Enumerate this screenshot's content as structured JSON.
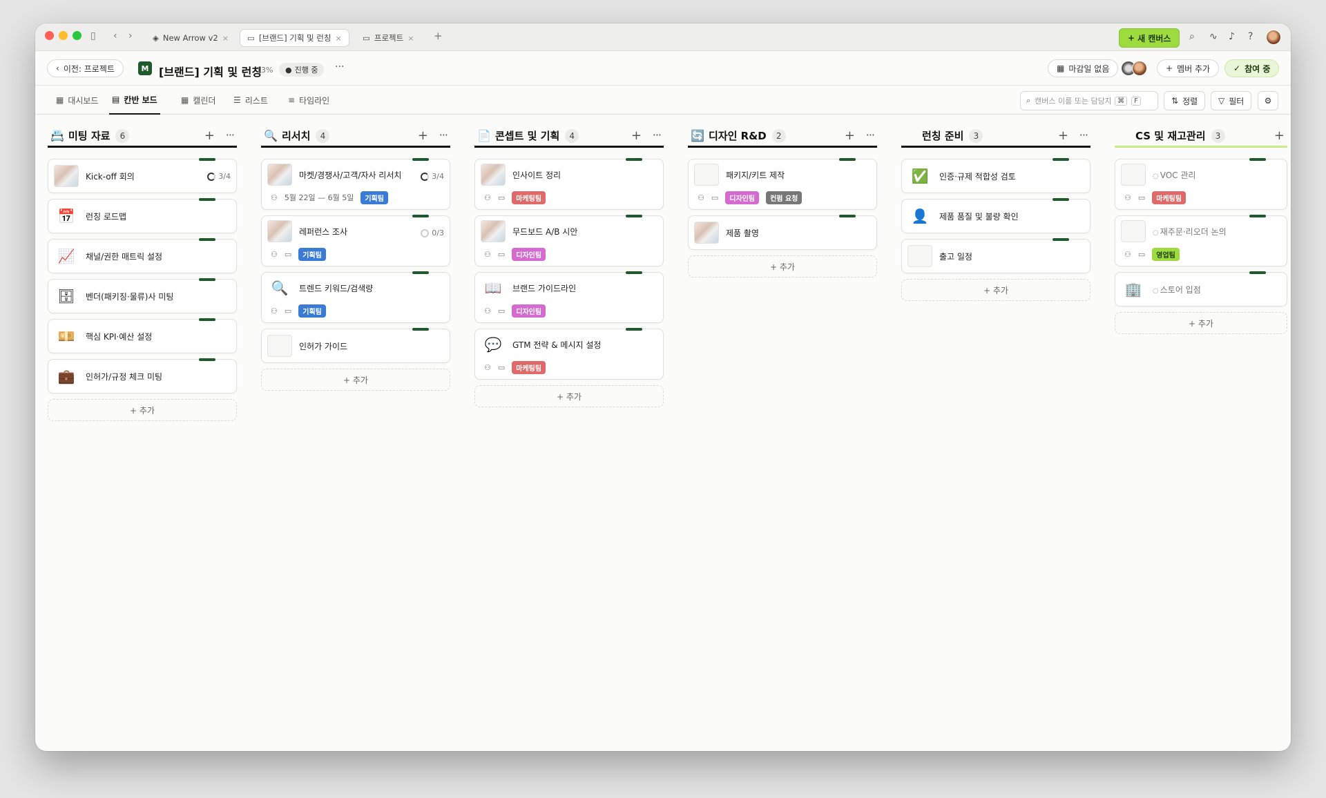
{
  "titlebar": {
    "tabs": [
      {
        "label": "New Arrow v2",
        "icon": "layers-icon"
      },
      {
        "label": "[브랜드] 기획 및 런칭",
        "icon": "folder-icon",
        "active": true
      },
      {
        "label": "프로젝트",
        "icon": "folder-icon"
      }
    ],
    "new_canvas_label": "새 캔버스"
  },
  "header": {
    "back_label": "이전: 프로젝트",
    "title": "[브랜드] 기획 및 런칭",
    "progress": "13%",
    "status": "진행 중",
    "more": "···",
    "deadline": "마감일 없음",
    "add_member": "멤버 추가",
    "participating": "참여 중"
  },
  "nav": {
    "tabs": [
      {
        "label": "대시보드"
      },
      {
        "label": "칸반 보드",
        "active": true
      },
      {
        "label": "캘린더"
      },
      {
        "label": "리스트"
      },
      {
        "label": "타임라인"
      }
    ],
    "search_placeholder": "캔버스 이름 또는 담당자",
    "shortcut_cmd": "⌘",
    "shortcut_key": "F",
    "sort_label": "정렬",
    "filter_label": "필터"
  },
  "add_label": "+ 추가",
  "columns": [
    {
      "name": "미팅 자료",
      "count": "6",
      "icon": "📇",
      "cards": [
        {
          "name": "Kick-off 회의",
          "thumb": "img",
          "progress": "3/4"
        },
        {
          "name": "런칭 로드맵",
          "thumb": "📅"
        },
        {
          "name": "채널/권한 매트릭 설정",
          "thumb": "📈"
        },
        {
          "name": "벤더(패키징·물류)사 미팅",
          "thumb": "🗄"
        },
        {
          "name": "핵심 KPI·예산 설정",
          "thumb": "💴"
        },
        {
          "name": "인허가/규정 체크 미팅",
          "thumb": "💼"
        }
      ]
    },
    {
      "name": "리서치",
      "count": "4",
      "icon": "🔍",
      "cards": [
        {
          "name": "마켓/경쟁사/고객/자사 리서치",
          "thumb": "img",
          "progress": "3/4",
          "date": "5월 22일 — 6월 5일",
          "tags": [
            {
              "label": "기획팀",
              "color": "#3a7bd5"
            }
          ]
        },
        {
          "name": "레퍼런스 조사",
          "thumb": "img",
          "progress": "0/3",
          "progress_empty": true,
          "tags": [
            {
              "label": "기획팀",
              "color": "#3a7bd5"
            }
          ]
        },
        {
          "name": "트렌드 키워드/검색량",
          "thumb": "🔍",
          "tags": [
            {
              "label": "기획팀",
              "color": "#3a7bd5"
            }
          ]
        },
        {
          "name": "인허가 가이드",
          "thumb": "doc"
        }
      ]
    },
    {
      "name": "콘셉트 및 기획",
      "count": "4",
      "icon": "📄",
      "cards": [
        {
          "name": "인사이트 정리",
          "thumb": "img",
          "tags": [
            {
              "label": "마케팅팀",
              "color": "#e06a6a"
            }
          ]
        },
        {
          "name": "무드보드 A/B 시안",
          "thumb": "img",
          "tags": [
            {
              "label": "디자인팀",
              "color": "#d56bd0"
            }
          ]
        },
        {
          "name": "브랜드 가이드라인",
          "thumb": "📖",
          "tags": [
            {
              "label": "디자인팀",
              "color": "#d56bd0"
            }
          ]
        },
        {
          "name": "GTM 전략 & 메시지 설정",
          "thumb": "💬",
          "tags": [
            {
              "label": "마케팅팀",
              "color": "#e06a6a"
            }
          ]
        }
      ]
    },
    {
      "name": "디자인 R&D",
      "count": "2",
      "icon": "🔄",
      "cards": [
        {
          "name": "패키지/키트 제작",
          "thumb": "doc",
          "tags": [
            {
              "label": "디자인팀",
              "color": "#d56bd0"
            },
            {
              "label": "컨펌 요청",
              "color": "#777777"
            }
          ]
        },
        {
          "name": "제품 촬영",
          "thumb": "img"
        }
      ]
    },
    {
      "name": "런칭 준비",
      "count": "3",
      "icon": "",
      "cards": [
        {
          "name": "인증·규제 적합성 검토",
          "thumb": "✅"
        },
        {
          "name": "제품 품질 및 불량 확인",
          "thumb": "👤"
        },
        {
          "name": "출고 일정",
          "thumb": "doc"
        }
      ]
    },
    {
      "name": "CS 및 재고관리",
      "count": "3",
      "icon": "",
      "cards": [
        {
          "name": "VOC 관리",
          "thumb": "doc",
          "muted": true,
          "tags": [
            {
              "label": "마케팅팀",
              "color": "#e06a6a"
            }
          ]
        },
        {
          "name": "재주문·리오더 논의",
          "thumb": "doc",
          "muted": true,
          "tags": [
            {
              "label": "영업팀",
              "color": "#9ddb3e"
            }
          ]
        },
        {
          "name": "스토어 입점",
          "thumb": "🏢",
          "muted": true
        }
      ]
    }
  ]
}
